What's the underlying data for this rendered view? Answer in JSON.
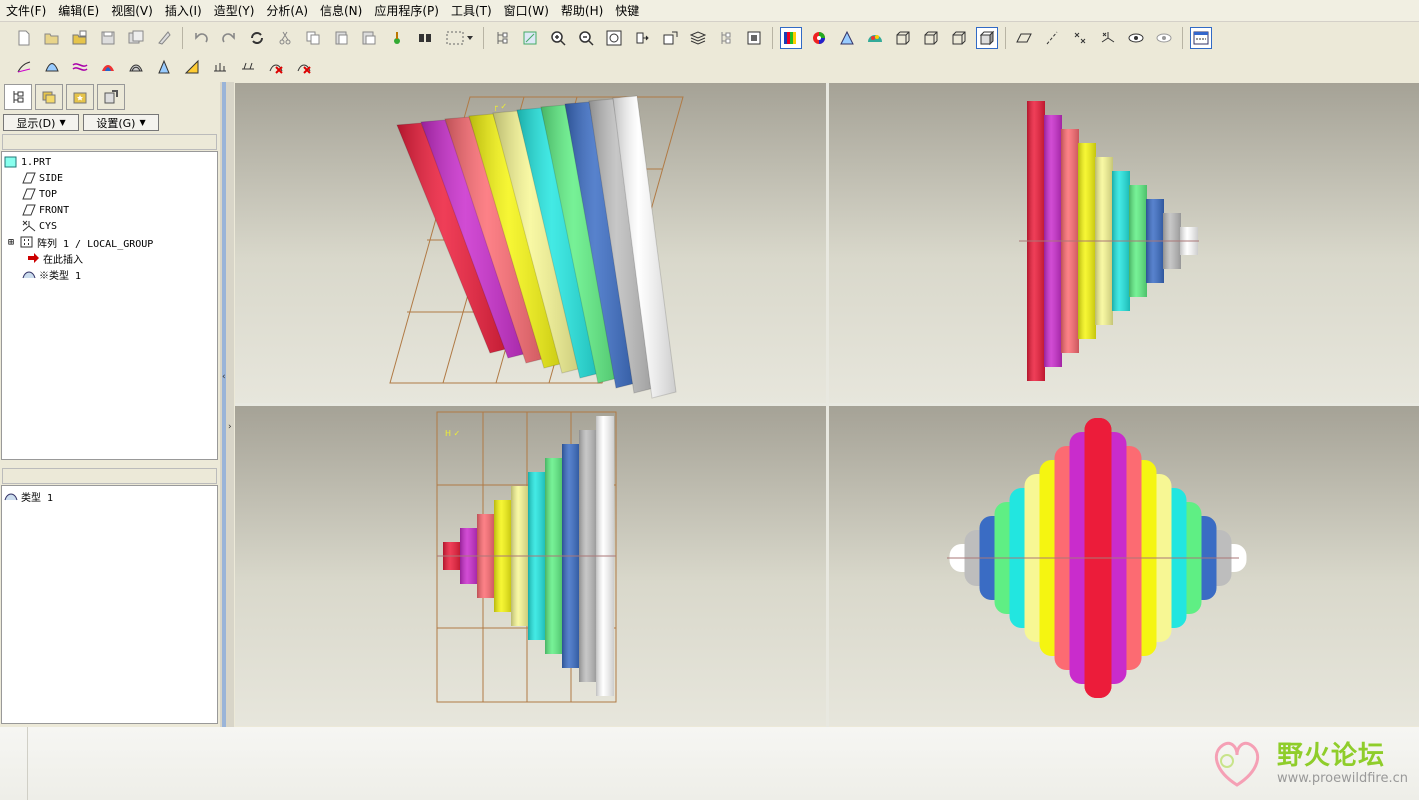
{
  "menubar": {
    "items": [
      "文件(F)",
      "编辑(E)",
      "视图(V)",
      "插入(I)",
      "造型(Y)",
      "分析(A)",
      "信息(N)",
      "应用程序(P)",
      "工具(T)",
      "窗口(W)",
      "帮助(H)",
      "快键"
    ]
  },
  "toolbar1": {
    "icons": [
      "new-icon",
      "open-icon",
      "open-session-icon",
      "save-icon",
      "save-copy-icon",
      "erase-icon",
      "undo-icon",
      "redo-icon",
      "regenerate-icon",
      "cut-icon",
      "copy-icon",
      "paste-icon",
      "paste-special-icon",
      "model-player-icon",
      "find-icon",
      "select-box-icon",
      "tree-icon",
      "repaint-icon",
      "zoom-in-icon",
      "zoom-out-icon",
      "refit-icon",
      "reorient-icon",
      "saved-views-icon",
      "layers-icon",
      "model-tree-icon",
      "view-manager-icon",
      "appearance-icon",
      "color-wheel-icon",
      "perspective-icon",
      "render-icon",
      "wireframe-icon",
      "hidden-line-icon",
      "no-hidden-icon",
      "shading-icon",
      "datum-plane-icon",
      "datum-axis-icon",
      "datum-point-icon",
      "coord-sys-icon",
      "spin-center-icon",
      "show-icon",
      "toggle-display-icon"
    ]
  },
  "toolbar2": {
    "icons": [
      "curvature-icon",
      "section-icon",
      "offset-icon",
      "shaded-curvature-icon",
      "reflection-icon",
      "draft-icon",
      "slope-icon",
      "dihedral-icon",
      "deviation-icon",
      "delete-analysis-icon",
      "hide-analysis-icon"
    ]
  },
  "leftpanel": {
    "tabs": [
      "model-tree-tab",
      "folder-browser-tab",
      "favorites-tab",
      "connections-tab"
    ],
    "display_label": "显示(D)",
    "settings_label": "设置(G)",
    "tree": [
      {
        "label": "1.PRT",
        "icon": "part-icon"
      },
      {
        "label": "SIDE",
        "icon": "datum-plane-icon"
      },
      {
        "label": "TOP",
        "icon": "datum-plane-icon"
      },
      {
        "label": "FRONT",
        "icon": "datum-plane-icon"
      },
      {
        "label": "CYS",
        "icon": "coord-sys-icon"
      },
      {
        "label": "阵列 1 / LOCAL_GROUP",
        "icon": "pattern-icon"
      },
      {
        "label": "在此插入",
        "icon": "insert-arrow-icon"
      },
      {
        "label": "※类型 1",
        "icon": "style-icon"
      }
    ],
    "bottom_tree": [
      {
        "label": "类型 1",
        "icon": "style-icon"
      }
    ]
  },
  "logo": {
    "main": "野火论坛",
    "url": "www.proewildfire.cn"
  },
  "colors": {
    "stripes": [
      "#ec1c3a",
      "#c92ccc",
      "#fc6b72",
      "#f5f511",
      "#f7f794",
      "#22e6e0",
      "#5fef84",
      "#3a6cc4",
      "#bdbdbd",
      "#ffffff"
    ]
  }
}
